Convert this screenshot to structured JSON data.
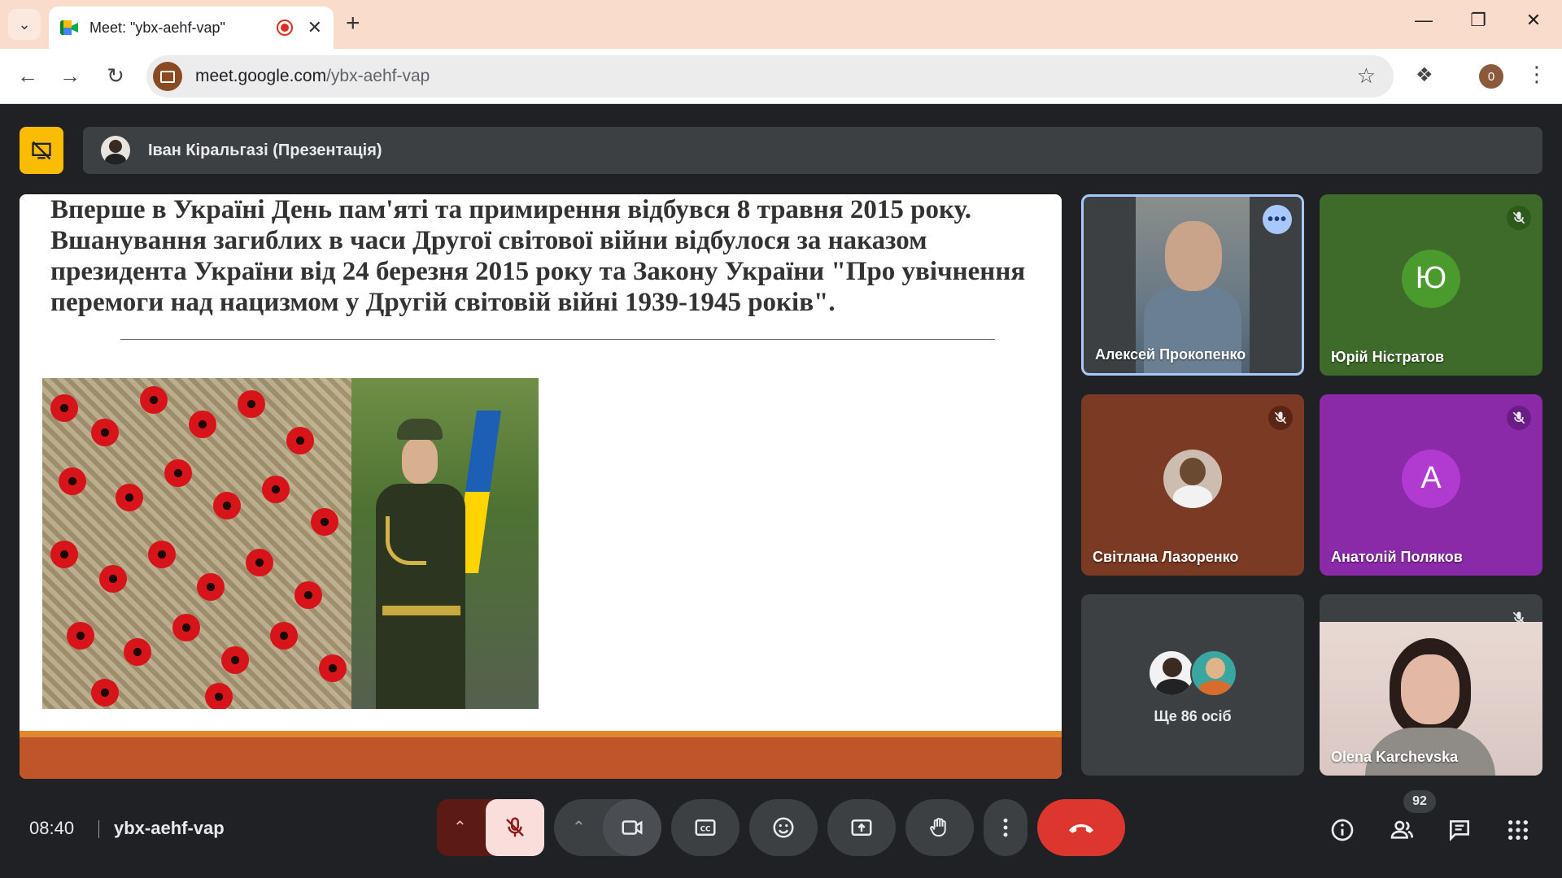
{
  "browser": {
    "tab_title": "Meet: \"ybx-aehf-vap\"",
    "url_host": "meet.google.com",
    "url_path": "/ybx-aehf-vap",
    "profile_initial": "0"
  },
  "meet": {
    "presenter_label": "Іван Кіральгазі (Презентація)",
    "slide": {
      "text": "Вперше в Україні День пам'яті та примирення відбувся 8 травня 2015 року. Вшанування загиблих в часи Другої світової війни відбулося за наказом президента України від 24 березня 2015 року та Закону України \"Про увічнення перемоги над нацизмом у Другій світовій війні 1939-1945 років\"."
    },
    "participants": [
      {
        "name": "Алексей Прокопенко"
      },
      {
        "name": "Юрій Ністратов",
        "initial": "Ю"
      },
      {
        "name": "Світлана Лазоренко"
      },
      {
        "name": "Анатолій Поляков",
        "initial": "А"
      },
      {
        "name": "Olena Karchevska"
      }
    ],
    "more_label": "Ще 86 осіб",
    "clock": "08:40",
    "meeting_code": "ybx-aehf-vap",
    "people_count": "92"
  },
  "colors": {
    "accent_blue": "#a8c7fa",
    "end_call_red": "#dc362e",
    "present_yellow": "#fbbc04",
    "slide_footer": "#c0552a"
  }
}
